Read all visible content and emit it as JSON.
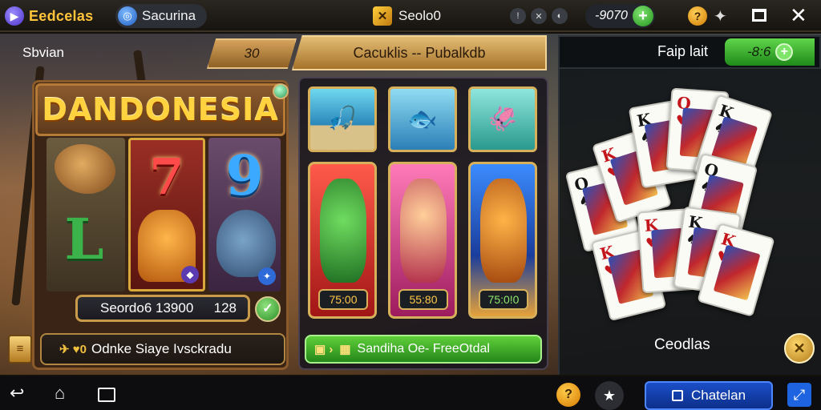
{
  "topbar": {
    "brand": "Eedcelas",
    "account": "Sacurina",
    "center_title": "Seolo0",
    "balance": "-9070",
    "icons": [
      "brand-logo-icon",
      "globe-icon",
      "coin-icon",
      "status-icons",
      "plus-icon",
      "help-icon",
      "pin-icon",
      "window-icon",
      "close-icon"
    ]
  },
  "left": {
    "label": "Sbvian",
    "slot_title": "DANDONESIA",
    "score": "Seordo6 13900",
    "score_right": "128",
    "action_text": "Odnke Siaye Ivsckradu",
    "action_icons": "✈ ♥0"
  },
  "middle": {
    "tab_small": "30",
    "tab_main": "Cacuklis -- Pubalkdb",
    "prices": [
      "75:00",
      "55:80",
      "75:0!0"
    ],
    "action_text": "Sandiha Oe- FreeOtdal"
  },
  "right": {
    "label": "Faip lait",
    "balance": "-8:6",
    "caption": "Ceodlas",
    "cards": [
      {
        "rank": "Q",
        "suit": "♠"
      },
      {
        "rank": "K",
        "suit": "♥"
      },
      {
        "rank": "K",
        "suit": "♠"
      },
      {
        "rank": "Q",
        "suit": "♥"
      },
      {
        "rank": "K",
        "suit": "♠"
      },
      {
        "rank": "Q",
        "suit": "♠"
      },
      {
        "rank": "K",
        "suit": "♥"
      },
      {
        "rank": "K",
        "suit": "♥"
      },
      {
        "rank": "K",
        "suit": "♠"
      },
      {
        "rank": "K",
        "suit": "♥"
      }
    ]
  },
  "bottombar": {
    "chat_label": "Chatelan"
  }
}
